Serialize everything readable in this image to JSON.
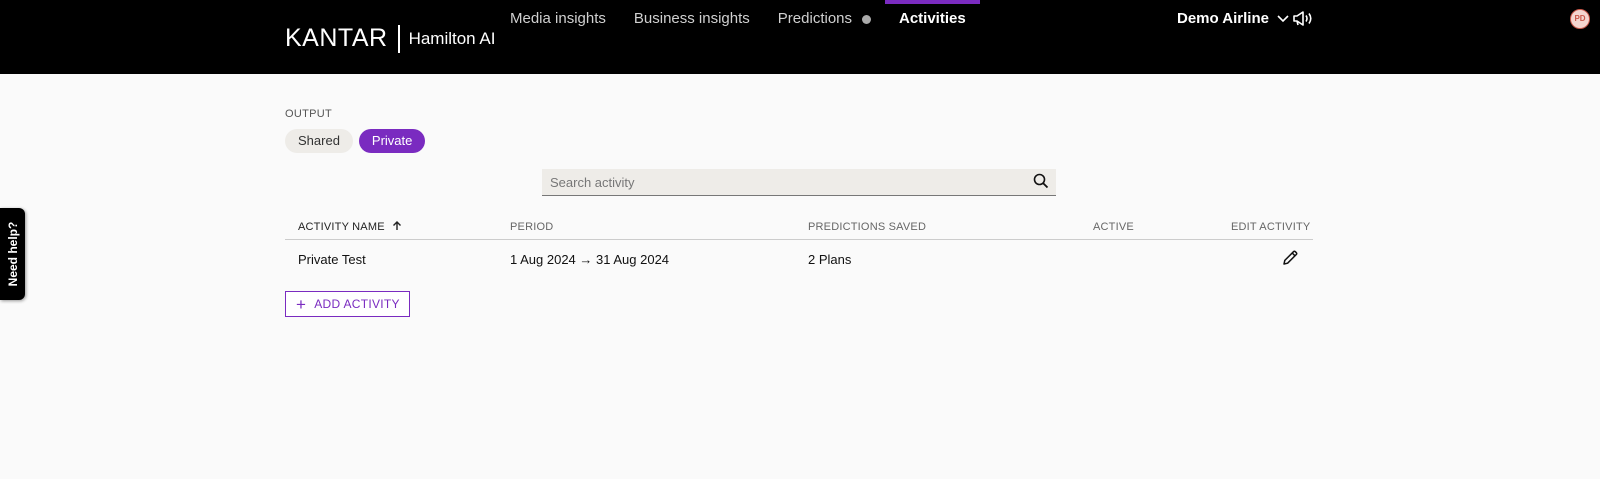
{
  "header": {
    "brand": "KANTAR",
    "product": "Hamilton AI",
    "nav": [
      {
        "label": "Media insights"
      },
      {
        "label": "Business insights"
      },
      {
        "label": "Predictions"
      },
      {
        "label": "Activities"
      }
    ],
    "account": "Demo Airline",
    "avatar_initials": "PD",
    "accent_color": "#7a2bc0"
  },
  "help_tab": "Need help?",
  "output": {
    "label": "OUTPUT",
    "options": [
      "Shared",
      "Private"
    ],
    "selected": "Private"
  },
  "search": {
    "placeholder": "Search activity",
    "value": ""
  },
  "table": {
    "columns": [
      "ACTIVITY NAME",
      "PERIOD",
      "PREDICTIONS SAVED",
      "ACTIVE",
      "EDIT ACTIVITY"
    ],
    "sort": {
      "column": "ACTIVITY NAME",
      "direction": "ascending"
    },
    "rows": [
      {
        "name": "Private Test",
        "period": "1 Aug 2024 → 31 Aug 2024",
        "predictions_saved": "2 Plans",
        "active": ""
      }
    ]
  },
  "add_activity_label": "ADD ACTIVITY"
}
